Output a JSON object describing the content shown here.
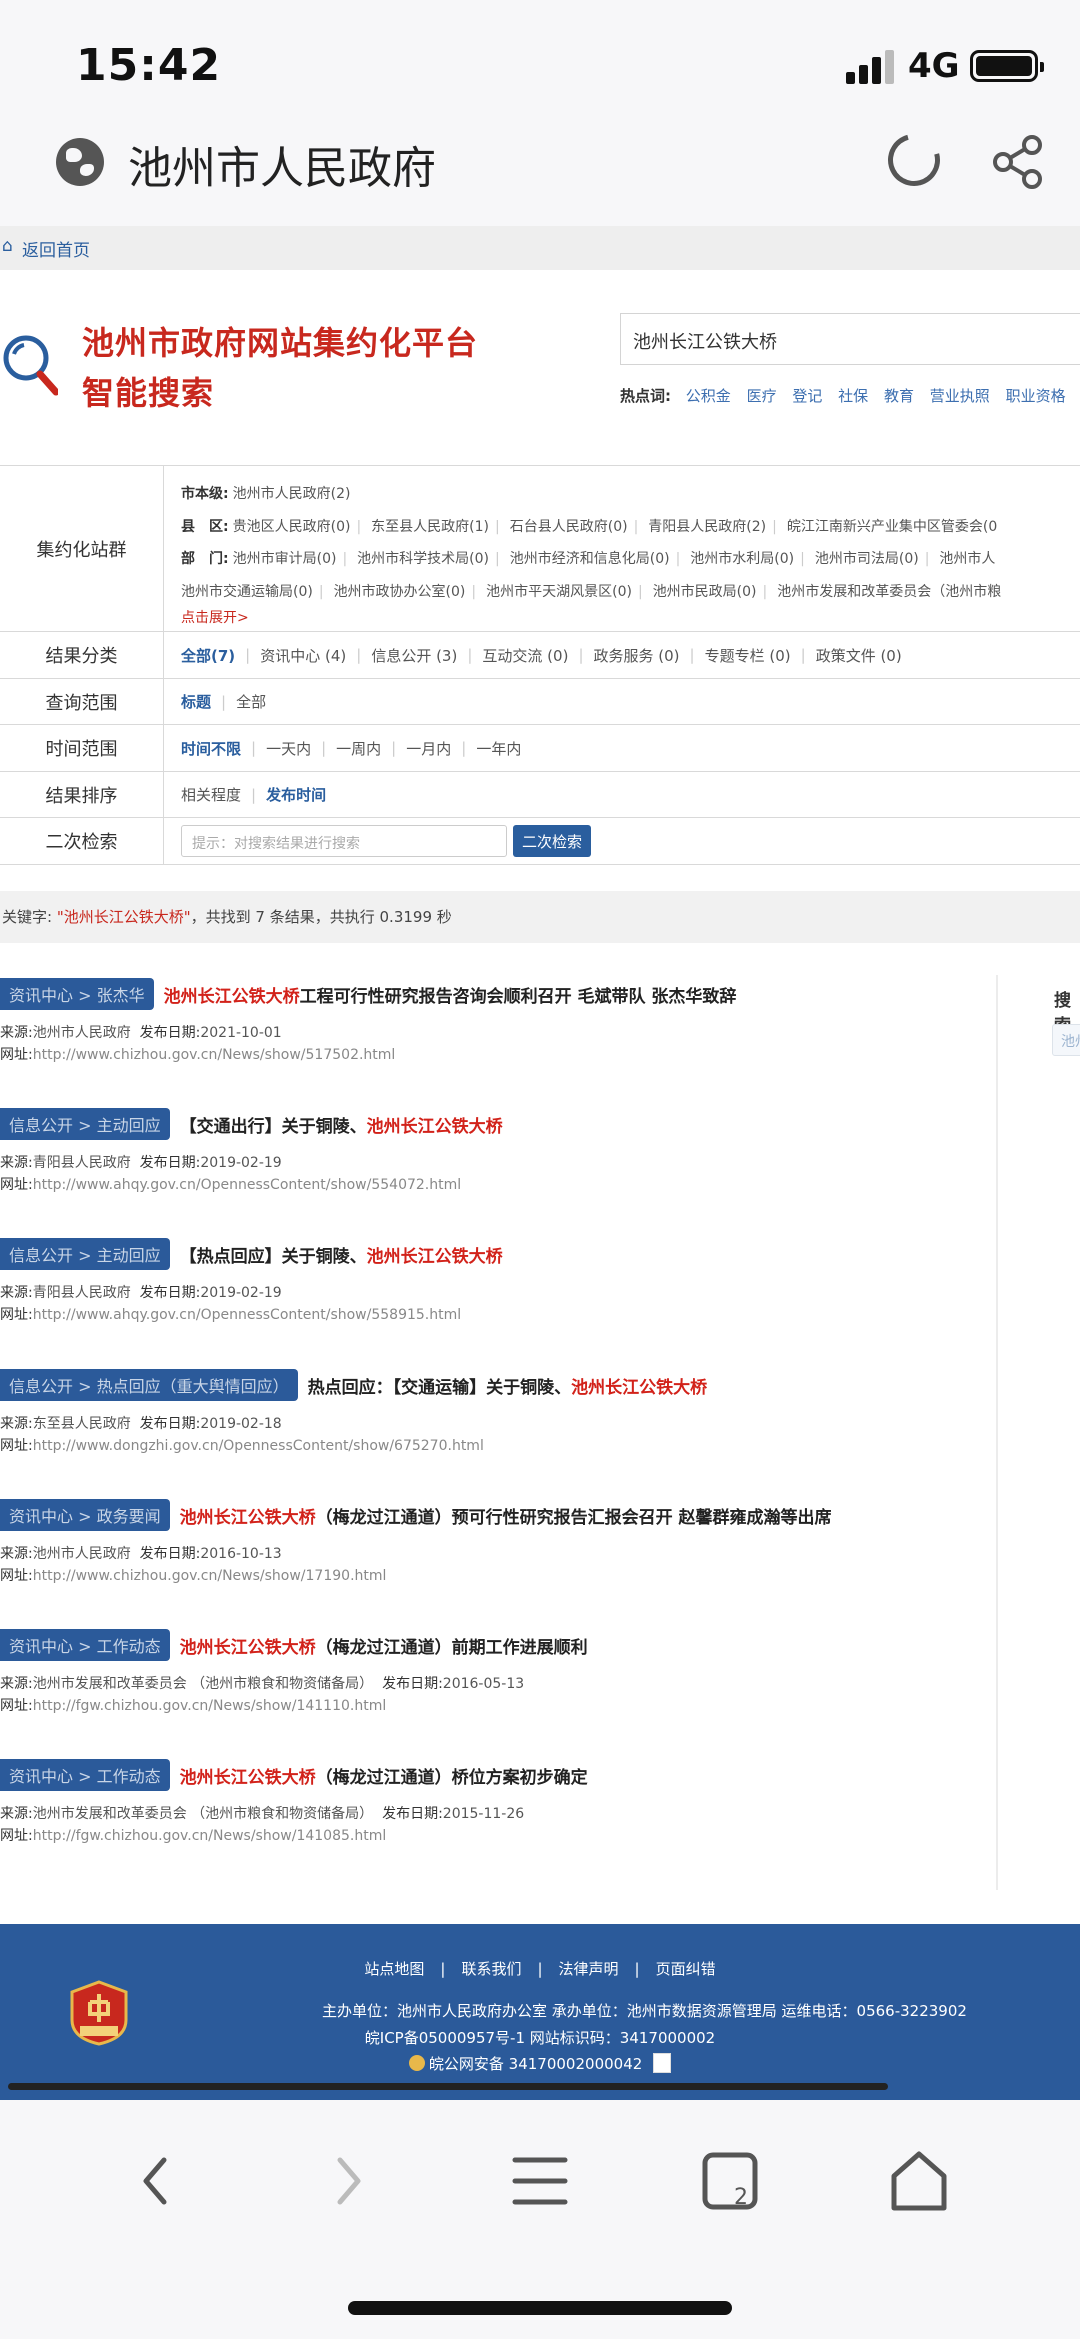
{
  "status_bar": {
    "time": "15:42",
    "network": "4G"
  },
  "browser": {
    "title": "池州市人民政府"
  },
  "nav": {
    "back_home": "返回首页"
  },
  "search": {
    "logo_line1": "池州市政府网站集约化平台",
    "logo_line2": "智能搜索",
    "query": "池州长江公铁大桥",
    "hot_label": "热点词:",
    "hot_words": [
      "公积金",
      "医疗",
      "登记",
      "社保",
      "教育",
      "营业执照",
      "职业资格"
    ]
  },
  "filters": {
    "site_group": {
      "label": "集约化站群",
      "city_label": "市本级:",
      "city": [
        "池州市人民政府(2)"
      ],
      "county_label": "县　区:",
      "counties": [
        "贵池区人民政府(0)",
        "东至县人民政府(1)",
        "石台县人民政府(0)",
        "青阳县人民政府(2)",
        "皖江江南新兴产业集中区管委会(0"
      ],
      "dept_label": "部　门:",
      "depts1": [
        "池州市审计局(0)",
        "池州市科学技术局(0)",
        "池州市经济和信息化局(0)",
        "池州市水利局(0)",
        "池州市司法局(0)",
        "池州市人"
      ],
      "depts2": [
        "池州市交通运输局(0)",
        "池州市政协办公室(0)",
        "池州市平天湖风景区(0)",
        "池州市民政局(0)",
        "池州市发展和改革委员会（池州市粮"
      ],
      "expand": "点击展开>"
    },
    "category": {
      "label": "结果分类",
      "options": [
        "全部(7)",
        "资讯中心 (4)",
        "信息公开 (3)",
        "互动交流 (0)",
        "政务服务 (0)",
        "专题专栏 (0)",
        "政策文件 (0)"
      ]
    },
    "scope": {
      "label": "查询范围",
      "options": [
        "标题",
        "全部"
      ]
    },
    "time": {
      "label": "时间范围",
      "options": [
        "时间不限",
        "一天内",
        "一周内",
        "一月内",
        "一年内"
      ]
    },
    "sort": {
      "label": "结果排序",
      "options": [
        "相关程度",
        "发布时间"
      ]
    },
    "refine": {
      "label": "二次检索",
      "placeholder": "提示：对搜索结果进行搜索",
      "button": "二次检索"
    }
  },
  "summary": {
    "prefix": "关键字:",
    "keyword": "\"池州长江公铁大桥\"",
    "rest": "，共找到 7 条结果，共执行 0.3199 秒"
  },
  "sidebar": {
    "title": "搜索",
    "chip": "池州"
  },
  "results": [
    {
      "tag": "资讯中心 > 张杰华",
      "title_pre": "",
      "title_hl": "池州长江公铁大桥",
      "title_post": "工程可行性研究报告咨询会顺利召开 毛斌带队 张杰华致辞",
      "source": "池州市人民政府",
      "date": "2021-10-01",
      "url": "http://www.chizhou.gov.cn/News/show/517502.html"
    },
    {
      "tag": "信息公开 > 主动回应",
      "title_pre": "【交通出行】关于铜陵、",
      "title_hl": "池州长江公铁大桥",
      "title_post": "",
      "source": "青阳县人民政府",
      "date": "2019-02-19",
      "url": "http://www.ahqy.gov.cn/OpennessContent/show/554072.html"
    },
    {
      "tag": "信息公开 > 主动回应",
      "title_pre": "【热点回应】关于铜陵、",
      "title_hl": "池州长江公铁大桥",
      "title_post": "",
      "source": "青阳县人民政府",
      "date": "2019-02-19",
      "url": "http://www.ahqy.gov.cn/OpennessContent/show/558915.html"
    },
    {
      "tag": "信息公开 > 热点回应（重大舆情回应）",
      "title_pre": "热点回应：【交通运输】关于铜陵、",
      "title_hl": "池州长江公铁大桥",
      "title_post": "",
      "source": "东至县人民政府",
      "date": "2019-02-18",
      "url": "http://www.dongzhi.gov.cn/OpennessContent/show/675270.html"
    },
    {
      "tag": "资讯中心 > 政务要闻",
      "title_pre": "",
      "title_hl": "池州长江公铁大桥",
      "title_post": "（梅龙过江通道）预可行性研究报告汇报会召开 赵馨群雍成瀚等出席",
      "source": "池州市人民政府",
      "date": "2016-10-13",
      "url": "http://www.chizhou.gov.cn/News/show/17190.html"
    },
    {
      "tag": "资讯中心 > 工作动态",
      "title_pre": "",
      "title_hl": "池州长江公铁大桥",
      "title_post": "（梅龙过江通道）前期工作进展顺利",
      "source": "池州市发展和改革委员会 （池州市粮食和物资储备局）",
      "date": "2016-05-13",
      "url": "http://fgw.chizhou.gov.cn/News/show/141110.html"
    },
    {
      "tag": "资讯中心 > 工作动态",
      "title_pre": "",
      "title_hl": "池州长江公铁大桥",
      "title_post": "（梅龙过江通道）桥位方案初步确定",
      "source": "池州市发展和改革委员会 （池州市粮食和物资储备局）",
      "date": "2015-11-26",
      "url": "http://fgw.chizhou.gov.cn/News/show/141085.html"
    }
  ],
  "result_labels": {
    "source": "来源:",
    "date": "发布日期:",
    "url": "网址:"
  },
  "footer": {
    "links": [
      "站点地图",
      "联系我们",
      "法律声明",
      "页面纠错"
    ],
    "line2": "主办单位：池州市人民政府办公室  承办单位：池州市数据资源管理局  运维电话：0566-3223902",
    "line3": "皖ICP备05000957号-1  网站标识码：3417000002",
    "line4": "皖公网安备 34170002000042",
    "emblem_text": "党政机关"
  }
}
